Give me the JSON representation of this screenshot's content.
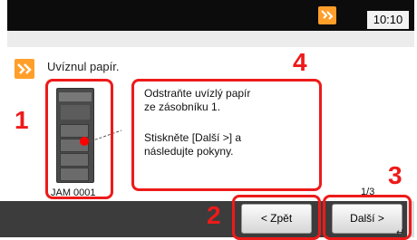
{
  "header": {
    "time": "10:10"
  },
  "message": {
    "title": "Uvíznul papír.",
    "line1": "Odstraňte uvízlý papír",
    "line2": "ze zásobníku 1.",
    "line3": "Stiskněte [Další >] a",
    "line4": "následujte pokyny."
  },
  "printer": {
    "jam_code": "JAM 0001"
  },
  "pager": {
    "text": "1/3"
  },
  "buttons": {
    "back": "< Zpět",
    "next": "Další >"
  },
  "callouts": [
    "1",
    "2",
    "3",
    "4"
  ],
  "colors": {
    "accent": "#ff9f2a",
    "highlight": "#ee1a1a"
  },
  "icons": [
    "paper-jam-icon",
    "enter-icon"
  ]
}
